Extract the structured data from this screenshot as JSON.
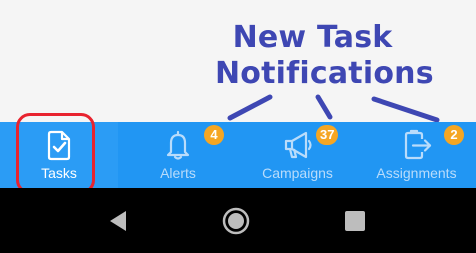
{
  "callout": {
    "line1": "New Task",
    "line2": "Notifications",
    "color": "#3e47b3"
  },
  "tabbar": {
    "background": "#2196f3",
    "tabs": [
      {
        "key": "tasks",
        "label": "Tasks",
        "icon": "task-document-icon",
        "selected": true
      },
      {
        "key": "alerts",
        "label": "Alerts",
        "icon": "bell-icon",
        "badge": "4"
      },
      {
        "key": "campaigns",
        "label": "Campaigns",
        "icon": "megaphone-icon",
        "badge": "37"
      },
      {
        "key": "assignments",
        "label": "Assignments",
        "icon": "clipboard-exit-icon",
        "badge": "2"
      }
    ],
    "badge_color": "#f5a623",
    "highlight_color": "#e8232f"
  },
  "navbar": {
    "buttons": [
      {
        "key": "back",
        "icon": "back-triangle-icon"
      },
      {
        "key": "home",
        "icon": "home-circle-icon"
      },
      {
        "key": "recents",
        "icon": "recents-square-icon"
      }
    ]
  }
}
